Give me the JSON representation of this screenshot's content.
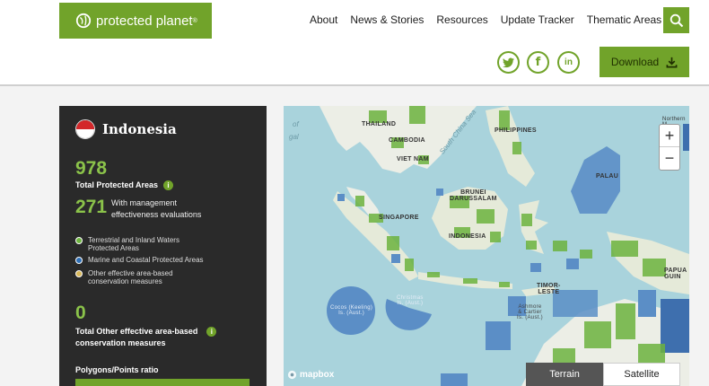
{
  "header": {
    "logo_text": "protected planet",
    "logo_mark": "®",
    "nav": [
      {
        "label": "About"
      },
      {
        "label": "News & Stories"
      },
      {
        "label": "Resources"
      },
      {
        "label": "Update Tracker"
      },
      {
        "label": "Thematic Areas"
      }
    ],
    "download_label": "Download",
    "social": [
      "twitter-icon",
      "facebook-icon",
      "linkedin-icon"
    ]
  },
  "panel": {
    "country": "Indonesia",
    "total_pa_value": "978",
    "total_pa_label": "Total Protected Areas",
    "mgmt_value": "271",
    "mgmt_label_1": "With management",
    "mgmt_label_2": "effectiveness evaluations",
    "legend": [
      {
        "text_1": "Terrestrial and Inland Waters",
        "text_2": "Protected Areas",
        "color": "#6db33f"
      },
      {
        "text_1": "Marine and Coastal Protected Areas",
        "text_2": "",
        "color": "#2f6fb5"
      },
      {
        "text_1": "Other effective area-based",
        "text_2": "conservation measures",
        "color": "#d8b85a"
      }
    ],
    "oecm_value": "0",
    "oecm_label_1": "Total Other effective area-based",
    "oecm_label_2": "conservation measures",
    "ratio_label": "Polygons/Points ratio"
  },
  "map": {
    "labels": {
      "thailand": "THAILAND",
      "cambodia": "CAMBODIA",
      "vietnam": "VIET NAM",
      "philippines": "PHILIPPINES",
      "palau": "PALAU",
      "brunei_1": "BRUNEI",
      "brunei_2": "DARUSSALAM",
      "singapore": "SINGAPORE",
      "indonesia": "INDONESIA",
      "timor_1": "TIMOR-",
      "timor_2": "LESTE",
      "papua_1": "PAPUA",
      "papua_2": "GUIN",
      "cocos_1": "Cocos (Keeling)",
      "cocos_2": "Is. (Aust.)",
      "christmas_1": "Christmas",
      "christmas_2": "Is. (Aust.)",
      "ashmore_1": "Ashmore",
      "ashmore_2": "& Cartier",
      "ashmore_3": "Is. (Aust.)",
      "northern_1": "Northern M",
      "northern_2": "Is. (U",
      "sea_1": "South China Sea",
      "sea_2": "of",
      "sea_3": "gal"
    },
    "attribution": "mapbox",
    "zoom_in": "+",
    "zoom_out": "−",
    "terrain_label": "Terrain",
    "satellite_label": "Satellite"
  }
}
